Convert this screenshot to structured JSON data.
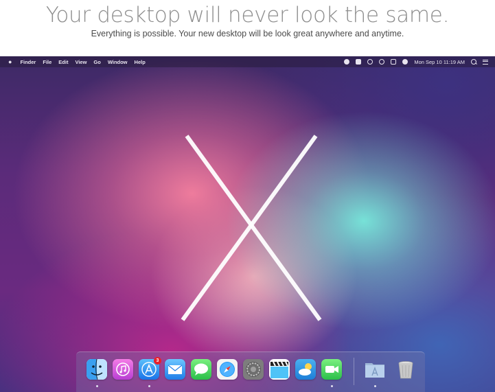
{
  "hero": {
    "title": "Your desktop will never look the same.",
    "subtitle": "Everything is possible. Your new desktop will be look great anywhere and anytime."
  },
  "menubar": {
    "apple_symbol": "",
    "items": [
      "Finder",
      "File",
      "Edit",
      "View",
      "Go",
      "Window",
      "Help"
    ],
    "clock": "Mon Sep 10  11:19 AM",
    "status_icons": [
      "dropbox-icon",
      "storage-icon",
      "chat-icon",
      "sync-icon",
      "bluetooth-icon",
      "volume-icon"
    ]
  },
  "dock": {
    "apps": [
      {
        "name": "Finder",
        "icon": "finder-icon",
        "running": true,
        "color": "#3aa0f0"
      },
      {
        "name": "iTunes",
        "icon": "itunes-icon",
        "running": false,
        "color": "#d94fd6"
      },
      {
        "name": "App Store",
        "icon": "app-store-icon",
        "running": true,
        "color": "#2f8ff0",
        "badge": "3"
      },
      {
        "name": "Mail",
        "icon": "mail-icon",
        "running": false,
        "color": "#3a9ff0"
      },
      {
        "name": "Messages",
        "icon": "messages-icon",
        "running": false,
        "color": "#4cd964"
      },
      {
        "name": "Safari",
        "icon": "safari-icon",
        "running": false,
        "color": "#1e88e5"
      },
      {
        "name": "System Preferences",
        "icon": "gear-icon",
        "running": false,
        "color": "#8a8a8a"
      },
      {
        "name": "Final Cut",
        "icon": "clapper-icon",
        "running": false,
        "color": "#333333"
      },
      {
        "name": "Weather",
        "icon": "weather-icon",
        "running": false,
        "color": "#4ab0f0"
      },
      {
        "name": "FaceTime",
        "icon": "facetime-icon",
        "running": true,
        "color": "#4cd964"
      },
      {
        "name": "Applications",
        "icon": "applications-folder-icon",
        "running": true,
        "color": "#9fb8d8"
      },
      {
        "name": "Trash",
        "icon": "trash-icon",
        "running": false,
        "color": "#c8c8c8"
      }
    ]
  },
  "colors": {
    "accent_badge": "#e8212b",
    "title_gray": "#8d8d8d"
  }
}
